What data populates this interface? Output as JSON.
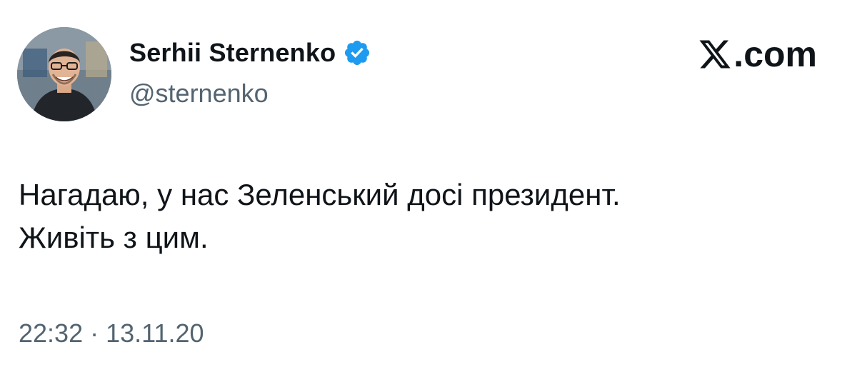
{
  "author": {
    "display_name": "Serhii Sternenko",
    "handle": "@sternenko",
    "verified": true,
    "avatar": "profile-photo"
  },
  "brand": {
    "icon": "x-logo-icon",
    "suffix": ".com"
  },
  "tweet": {
    "lines": [
      "Нагадаю, у нас Зеленський досі президент.",
      "Живіть з цим."
    ],
    "time": "22:32",
    "separator": "·",
    "date": "13.11.20"
  },
  "colors": {
    "text_primary": "#0f1419",
    "text_secondary": "#536471",
    "verified_badge": "#1d9bf0",
    "background": "#ffffff"
  }
}
